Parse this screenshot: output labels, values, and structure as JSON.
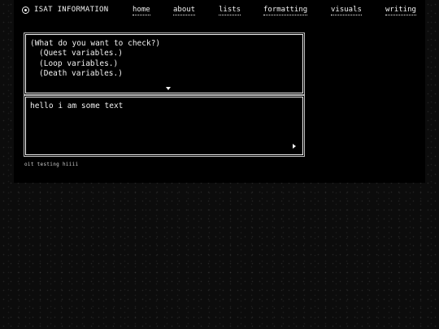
{
  "header": {
    "brand": "ISAT INFORMATION",
    "brand_icon": "circle-dot-icon",
    "nav": {
      "home": "home",
      "about": "about",
      "lists": "lists",
      "formatting": "formatting",
      "visuals": "visuals",
      "writing": "writing"
    }
  },
  "choice_box": {
    "question": "(What do you want to check?)",
    "options": [
      "(Quest variables.)",
      "(Loop variables.)",
      "(Death variables.)"
    ],
    "more_icon": "down-arrow-icon"
  },
  "dialogue_box": {
    "text": "hello i am some text",
    "advance_icon": "right-arrow-icon"
  },
  "footnote": "oit testing hiiii",
  "colors": {
    "background": "#0c0c0c",
    "panel": "#000000",
    "text": "#f2f2f2"
  }
}
